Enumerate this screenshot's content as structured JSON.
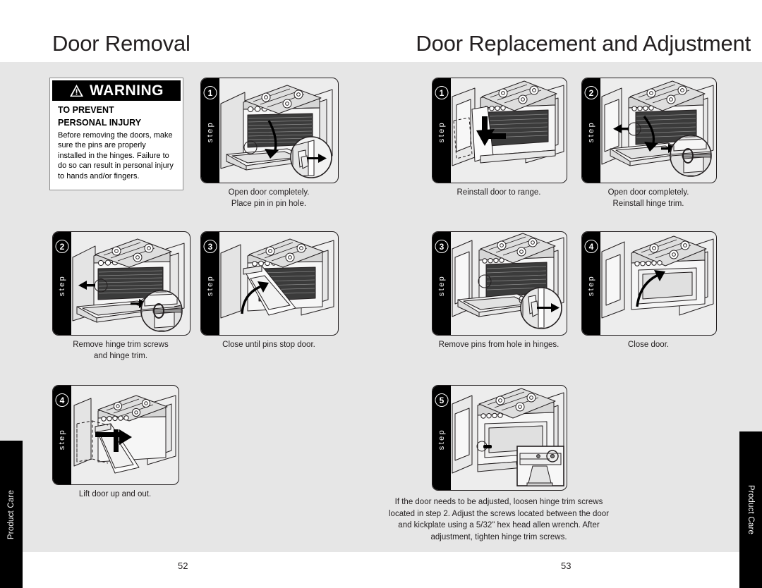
{
  "document": {
    "section_tab": "Product Care",
    "left_page": {
      "title": "Door Removal",
      "folio": "52"
    },
    "right_page": {
      "title": "Door Replacement and Adjustment",
      "folio": "53"
    }
  },
  "warning": {
    "banner": "WARNING",
    "icon": "warning-triangle-icon",
    "heading_line1": "TO PREVENT",
    "heading_line2": "PERSONAL INJURY",
    "body": "Before removing the doors, make sure the pins are properly installed in the hinges. Failure to do so can result in personal injury to hands and/or fingers."
  },
  "step_word": "step",
  "left_steps": [
    {
      "number": "1",
      "caption_line1": "Open door completely.",
      "caption_line2": "Place pin in pin hole.",
      "art": "range-door-open-pin-detail"
    },
    {
      "number": "2",
      "caption_line1": "Remove hinge trim screws",
      "caption_line2": "and hinge trim.",
      "art": "range-door-open-screw-detail"
    },
    {
      "number": "3",
      "caption_line1": "Close until pins stop door.",
      "caption_line2": "",
      "art": "range-door-closing"
    },
    {
      "number": "4",
      "caption_line1": "Lift door up and out.",
      "caption_line2": "",
      "art": "range-door-lift-off"
    }
  ],
  "right_steps": [
    {
      "number": "1",
      "caption_line1": "Reinstall door to range.",
      "caption_line2": "",
      "art": "range-door-reinstall"
    },
    {
      "number": "2",
      "caption_line1": "Open door completely.",
      "caption_line2": "Reinstall hinge trim.",
      "art": "range-door-open-trim-detail"
    },
    {
      "number": "3",
      "caption_line1": "Remove pins from hole in hinges.",
      "caption_line2": "",
      "art": "range-pins-remove-detail"
    },
    {
      "number": "4",
      "caption_line1": "Close door.",
      "caption_line2": "",
      "art": "range-door-close"
    },
    {
      "number": "5",
      "caption_paragraph": "If the door needs to be adjusted, loosen hinge trim screws located in step 2. Adjust the screws located between the door and kickplate using a 5/32\" hex head allen wrench. After adjustment, tighten hinge trim screws.",
      "art": "range-kickplate-adjust-detail"
    }
  ],
  "colors": {
    "page_background": "#ffffff",
    "content_band": "#e6e6e6",
    "panel_fill": "#ededed",
    "ink": "#231f20",
    "rail": "#000000"
  }
}
